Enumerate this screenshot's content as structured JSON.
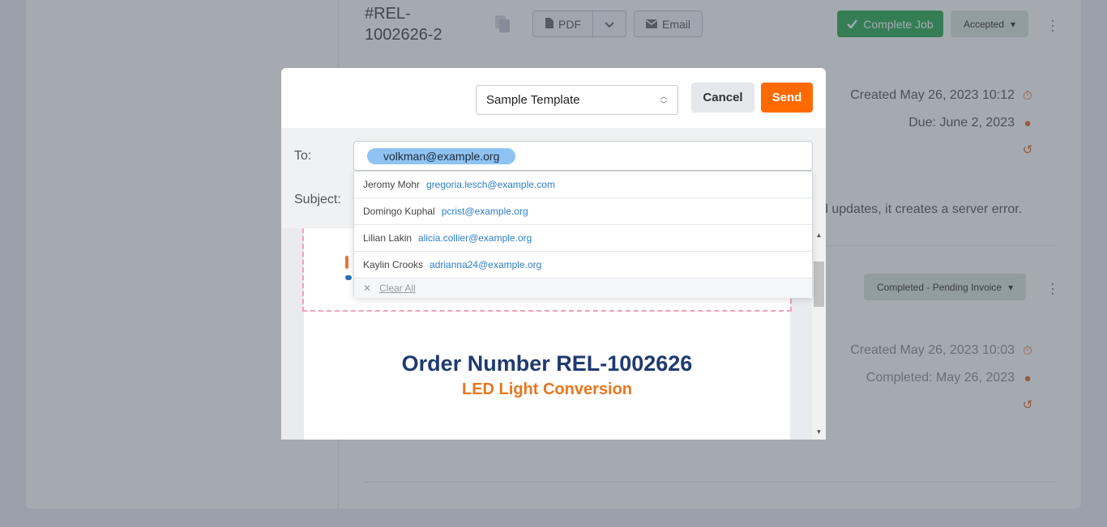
{
  "background": {
    "job_number": "#REL-1002626-2",
    "pdf_label": "PDF",
    "email_label": "Email",
    "complete_job_label": "Complete Job",
    "status_1": "Accepted",
    "created_1": "Created May 26, 2023 10:12",
    "due_1": "Due: June 2, 2023",
    "note": "d updates, it creates a server error.",
    "status_2": "Completed - Pending Invoice",
    "created_2": "Created May 26, 2023 10:03",
    "completed_2": "Completed: May 26, 2023"
  },
  "modal": {
    "template_select": "Sample Template",
    "cancel_label": "Cancel",
    "send_label": "Send",
    "to_label": "To:",
    "subject_label": "Subject:",
    "to_chip": "volkman@example.org"
  },
  "dropdown": {
    "items": [
      {
        "name": "Jeromy Mohr",
        "email": "gregoria.lesch@example.com"
      },
      {
        "name": "Domingo Kuphal",
        "email": "pcrist@example.org"
      },
      {
        "name": "Lilian Lakin",
        "email": "alicia.collier@example.org"
      },
      {
        "name": "Kaylin Crooks",
        "email": "adrianna24@example.org"
      }
    ],
    "clear_all": "Clear All"
  },
  "preview": {
    "order_title": "Order Number REL-1002626",
    "order_subtitle": "LED Light Conversion"
  },
  "colors": {
    "send": "#ff6a00",
    "complete": "#3fb15f",
    "chip": "#8fc3f2",
    "order_title": "#1f3a6e",
    "order_subtitle": "#e8761f"
  }
}
